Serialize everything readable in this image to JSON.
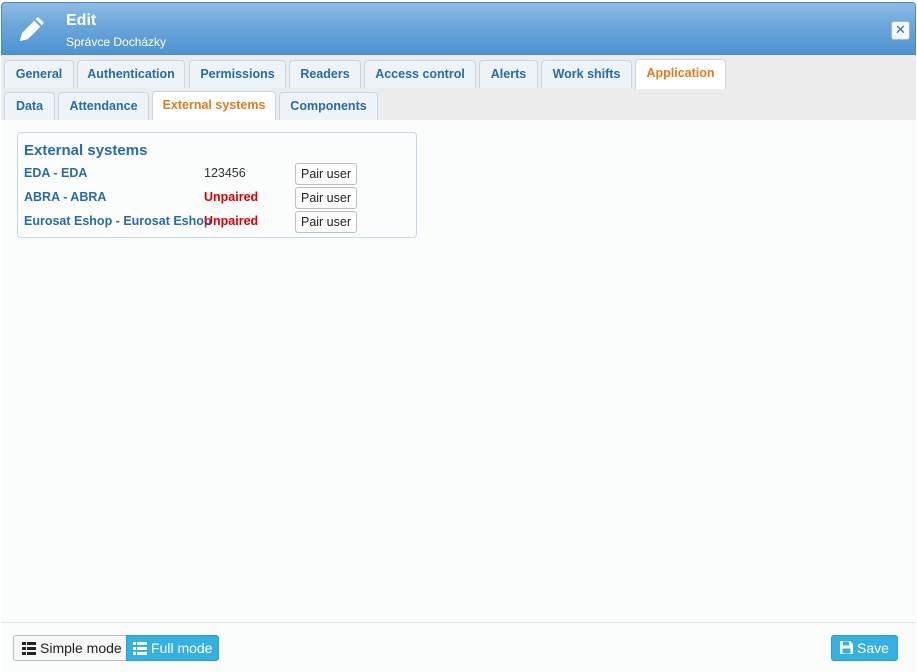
{
  "header": {
    "title": "Edit",
    "subtitle": "Správce Docházky",
    "close_label": "✕",
    "icon": "pencil-icon"
  },
  "tabs_primary": [
    {
      "label": "General"
    },
    {
      "label": "Authentication"
    },
    {
      "label": "Permissions"
    },
    {
      "label": "Readers"
    },
    {
      "label": "Access control"
    },
    {
      "label": "Alerts"
    },
    {
      "label": "Work shifts"
    },
    {
      "label": "Application",
      "active": true
    }
  ],
  "tabs_secondary": [
    {
      "label": "Data"
    },
    {
      "label": "Attendance"
    },
    {
      "label": "External systems",
      "active": true
    },
    {
      "label": "Components"
    }
  ],
  "external_systems": {
    "title": "External systems",
    "rows": [
      {
        "name": "EDA - EDA",
        "status": "123456",
        "state": "paired",
        "button": "Pair user"
      },
      {
        "name": "ABRA - ABRA",
        "status": "Unpaired",
        "state": "unpaired",
        "button": "Pair user"
      },
      {
        "name": "Eurosat Eshop - Eurosat Eshop",
        "status": "Unpaired",
        "state": "unpaired",
        "button": "Pair user"
      }
    ]
  },
  "footer": {
    "simple_mode": "Simple mode",
    "full_mode": "Full mode",
    "save": "Save",
    "active_mode": "full"
  },
  "colors": {
    "accent": "#35b0e0",
    "tab_text": "#2a6aaa",
    "active_tab": "#e07b1e",
    "unpaired": "#e00000"
  }
}
